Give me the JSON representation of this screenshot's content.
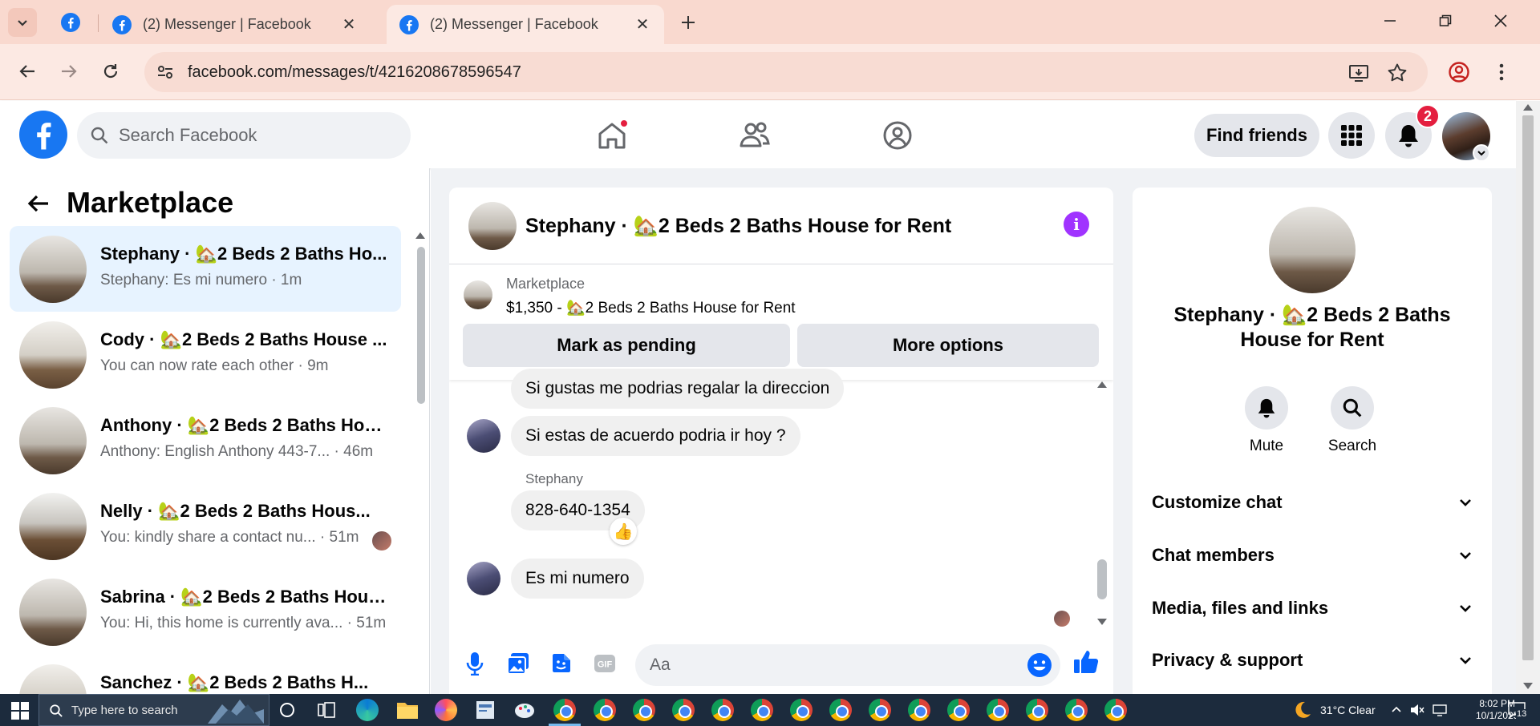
{
  "browser": {
    "tabs": [
      {
        "title": "(2) Messenger | Facebook",
        "active": false
      },
      {
        "title": "(2) Messenger | Facebook",
        "active": true
      }
    ],
    "url": "facebook.com/messages/t/4216208678596547"
  },
  "fb_header": {
    "search_placeholder": "Search Facebook",
    "find_friends": "Find friends",
    "notification_count": "2"
  },
  "sidebar": {
    "title": "Marketplace",
    "conversations": [
      {
        "name": "Stephany · 🏡2 Beds 2 Baths Ho...",
        "preview": "Stephany: Es mi numero · 1m",
        "selected": true
      },
      {
        "name": "Cody · 🏡2 Beds 2 Baths House ...",
        "preview": "You can now rate each other · 9m"
      },
      {
        "name": "Anthony · 🏡2 Beds 2 Baths Hou...",
        "preview": "Anthony: English Anthony 443-7... · 46m"
      },
      {
        "name": "Nelly · 🏡2 Beds 2 Baths Hous...",
        "preview": "You: kindly share a contact nu... · 51m"
      },
      {
        "name": "Sabrina · 🏡2 Beds 2 Baths Hous...",
        "preview": "You: Hi, this home is currently ava... · 51m"
      },
      {
        "name": "Sanchez · 🏡2 Beds 2 Baths H...",
        "preview": ""
      }
    ]
  },
  "chat": {
    "title": "Stephany · 🏡2 Beds 2 Baths House for Rent",
    "listing": {
      "label": "Marketplace",
      "price_line": "$1,350 - 🏡2 Beds 2 Baths House for Rent",
      "pending_btn": "Mark as pending",
      "more_btn": "More options"
    },
    "messages": [
      {
        "text": "Si gustas me podrias regalar la direccion"
      },
      {
        "text": "Si estas de acuerdo podria ir hoy ?"
      },
      {
        "sender": "Stephany",
        "text": "828-640-1354",
        "reaction": "👍"
      },
      {
        "text": "Es mi numero"
      }
    ],
    "composer_placeholder": "Aa"
  },
  "info_panel": {
    "name": "Stephany · 🏡2 Beds 2 Baths House for Rent",
    "actions": [
      {
        "label": "Mute"
      },
      {
        "label": "Search"
      }
    ],
    "sections": [
      "Customize chat",
      "Chat members",
      "Media, files and links",
      "Privacy & support"
    ]
  },
  "taskbar": {
    "search_placeholder": "Type here to search",
    "weather": "31°C  Clear",
    "time": "8:02 PM",
    "date": "10/1/2025",
    "notification_count": "13"
  },
  "colors": {
    "fb_blue": "#1877f2",
    "messenger_purple": "#a033ff",
    "chrome_tab_bg": "#f9d9cf",
    "selected_conv": "#e7f3ff"
  }
}
